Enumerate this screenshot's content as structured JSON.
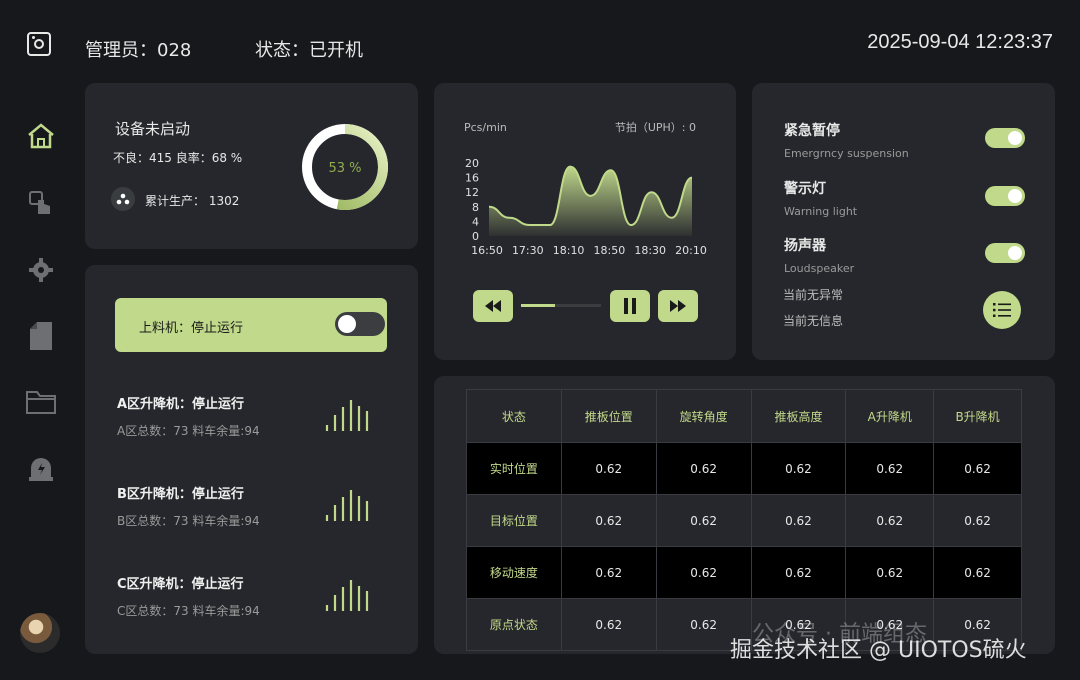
{
  "header": {
    "admin": "管理员：028",
    "status": "状态：已开机",
    "datetime": "2025-09-04 12:23:37"
  },
  "sidebar": {
    "items": [
      "home-icon",
      "touch-icon",
      "gear-icon",
      "document-icon",
      "folder-icon",
      "alarm-icon"
    ]
  },
  "device": {
    "title": "设备未启动",
    "stats": "不良：415  良率：68 %",
    "total": "累计生产：  1302",
    "ring_label": "53 %",
    "ring_percent": 53
  },
  "feeder": {
    "label": "上料机：停止运行"
  },
  "lifts": [
    {
      "name": "A区升降机：停止运行",
      "detail": "A区总数：73  料车余量:94"
    },
    {
      "name": "B区升降机：停止运行",
      "detail": "B区总数：73  料车余量:94"
    },
    {
      "name": "C区升降机：停止运行",
      "detail": "C区总数：73  料车余量:94"
    }
  ],
  "chart_data": {
    "type": "area",
    "ylabel": "Pcs/min",
    "subtitle": "节拍（UPH）: 0",
    "x_ticks": [
      "16:50",
      "17:30",
      "18:10",
      "18:50",
      "18:30",
      "20:10"
    ],
    "y_ticks": [
      20,
      16,
      12,
      8,
      4,
      0
    ],
    "ylim": [
      0,
      20
    ],
    "x": [
      0,
      1,
      2,
      3,
      4,
      5,
      6,
      7,
      8,
      9,
      10
    ],
    "values": [
      8,
      5,
      3,
      3,
      19,
      11,
      18,
      3,
      12,
      5,
      16
    ],
    "color": "#bfd68a"
  },
  "player": {
    "progress": 0.42
  },
  "alarms": [
    {
      "name": "紧急暂停",
      "en": "Emergrncy suspension",
      "on": true
    },
    {
      "name": "警示灯",
      "en": "Warning light",
      "on": true
    },
    {
      "name": "扬声器",
      "en": "Loudspeaker",
      "on": true
    }
  ],
  "messages": {
    "m1": "当前无异常",
    "m2": "当前无信息"
  },
  "table": {
    "headers": [
      "状态",
      "推板位置",
      "旋转角度",
      "推板高度",
      "A升降机",
      "B升降机"
    ],
    "rows": [
      {
        "label": "实时位置",
        "values": [
          "0.62",
          "0.62",
          "0.62",
          "0.62",
          "0.62"
        ]
      },
      {
        "label": "目标位置",
        "values": [
          "0.62",
          "0.62",
          "0.62",
          "0.62",
          "0.62"
        ]
      },
      {
        "label": "移动速度",
        "values": [
          "0.62",
          "0.62",
          "0.62",
          "0.62",
          "0.62"
        ]
      },
      {
        "label": "原点状态",
        "values": [
          "0.62",
          "0.62",
          "0.62",
          "0.62",
          "0.62"
        ]
      }
    ]
  },
  "watermark": {
    "text": "掘金技术社区 @ UIOTOS硫火",
    "text2": "公众号 · 前端组态"
  },
  "colors": {
    "accent": "#c0d98a",
    "bg": "#17181c",
    "card": "#26272c"
  }
}
